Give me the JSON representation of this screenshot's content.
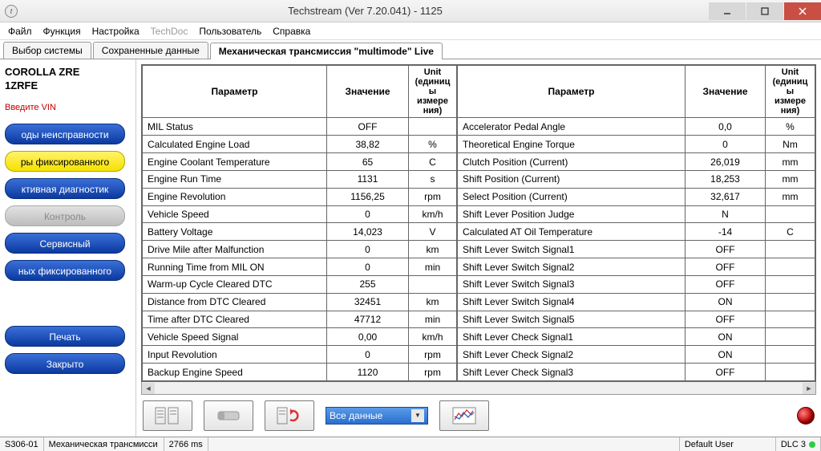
{
  "window": {
    "title": "Techstream (Ver 7.20.041) - 1125"
  },
  "menubar": {
    "file": "Файл",
    "func": "Функция",
    "setup": "Настройка",
    "techdoc": "TechDoc",
    "user": "Пользователь",
    "help": "Справка"
  },
  "tabs": {
    "t1": "Выбор системы",
    "t2": "Сохраненные данные",
    "t3": "Механическая трансмиссия \"multimode\" Live"
  },
  "sidebar": {
    "veh1": "COROLLA ZRE",
    "veh2": "1ZRFE",
    "vin": "Введите VIN",
    "b1": "оды неисправности",
    "b2": "ры фиксированного",
    "b3": "ктивная диагностик",
    "b4": "Контроль",
    "b5": "Сервисный",
    "b6": "ных фиксированного",
    "b7": "Печать",
    "b8": "Закрыто"
  },
  "headers": {
    "param": "Параметр",
    "value": "Значение",
    "unit": "Unit (единиц ы измере ния)"
  },
  "left": [
    {
      "p": "MIL Status",
      "v": "OFF",
      "u": ""
    },
    {
      "p": "Calculated Engine Load",
      "v": "38,82",
      "u": "%"
    },
    {
      "p": "Engine Coolant Temperature",
      "v": "65",
      "u": "C"
    },
    {
      "p": "Engine Run Time",
      "v": "1131",
      "u": "s"
    },
    {
      "p": "Engine Revolution",
      "v": "1156,25",
      "u": "rpm"
    },
    {
      "p": "Vehicle Speed",
      "v": "0",
      "u": "km/h"
    },
    {
      "p": "Battery Voltage",
      "v": "14,023",
      "u": "V"
    },
    {
      "p": "Drive Mile after Malfunction",
      "v": "0",
      "u": "km"
    },
    {
      "p": "Running Time from MIL ON",
      "v": "0",
      "u": "min"
    },
    {
      "p": "Warm-up Cycle Cleared DTC",
      "v": "255",
      "u": ""
    },
    {
      "p": "Distance from DTC Cleared",
      "v": "32451",
      "u": "km"
    },
    {
      "p": "Time after DTC Cleared",
      "v": "47712",
      "u": "min"
    },
    {
      "p": "Vehicle Speed Signal",
      "v": "0,00",
      "u": "km/h"
    },
    {
      "p": "Input Revolution",
      "v": "0",
      "u": "rpm"
    },
    {
      "p": "Backup Engine Speed",
      "v": "1120",
      "u": "rpm"
    }
  ],
  "right": [
    {
      "p": "Accelerator Pedal Angle",
      "v": "0,0",
      "u": "%"
    },
    {
      "p": "Theoretical Engine Torque",
      "v": "0",
      "u": "Nm"
    },
    {
      "p": "Clutch Position (Current)",
      "v": "26,019",
      "u": "mm"
    },
    {
      "p": "Shift Position (Current)",
      "v": "18,253",
      "u": "mm"
    },
    {
      "p": "Select Position (Current)",
      "v": "32,617",
      "u": "mm"
    },
    {
      "p": "Shift Lever Position Judge",
      "v": "N",
      "u": ""
    },
    {
      "p": "Calculated AT Oil Temperature",
      "v": "-14",
      "u": "C"
    },
    {
      "p": "Shift Lever Switch Signal1",
      "v": "OFF",
      "u": ""
    },
    {
      "p": "Shift Lever Switch Signal2",
      "v": "OFF",
      "u": ""
    },
    {
      "p": "Shift Lever Switch Signal3",
      "v": "OFF",
      "u": ""
    },
    {
      "p": "Shift Lever Switch Signal4",
      "v": "ON",
      "u": ""
    },
    {
      "p": "Shift Lever Switch Signal5",
      "v": "OFF",
      "u": ""
    },
    {
      "p": "Shift Lever Check Signal1",
      "v": "ON",
      "u": ""
    },
    {
      "p": "Shift Lever Check Signal2",
      "v": "ON",
      "u": ""
    },
    {
      "p": "Shift Lever Check Signal3",
      "v": "OFF",
      "u": ""
    }
  ],
  "toolbar": {
    "combo": "Все данные"
  },
  "status": {
    "s1": "S306-01",
    "s2": "Механическая трансмисси",
    "s3": "2766 ms",
    "user": "Default User",
    "dlc": "DLC 3"
  }
}
